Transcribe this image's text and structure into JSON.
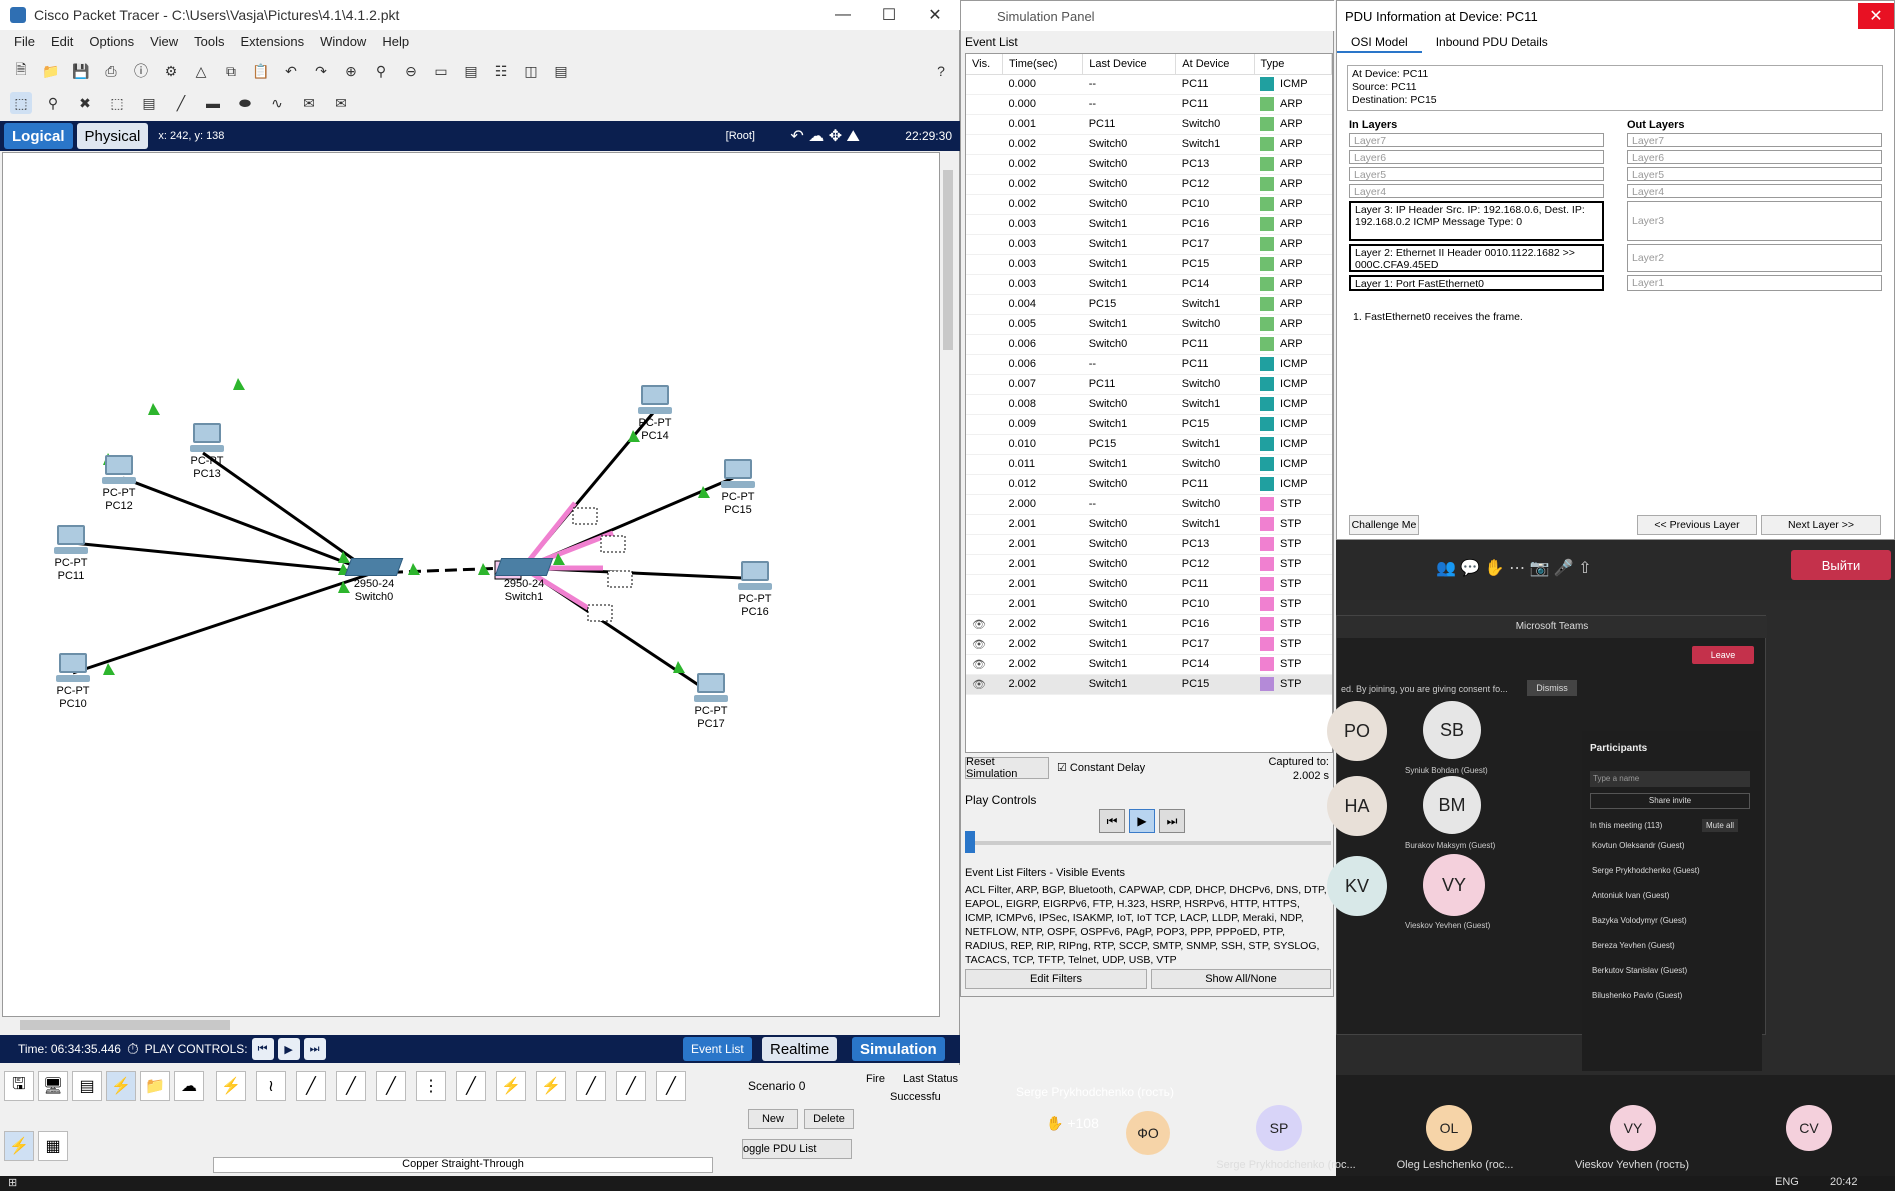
{
  "pt": {
    "title": "Cisco Packet Tracer - C:\\Users\\Vasja\\Pictures\\4.1\\4.1.2.pkt",
    "menu": [
      "File",
      "Edit",
      "Options",
      "View",
      "Tools",
      "Extensions",
      "Window",
      "Help"
    ],
    "tab_logical": "Logical",
    "tab_physical": "Physical",
    "coords": "x: 242, y: 138",
    "root": "[Root]",
    "clock": "22:29:30",
    "devices": {
      "pc10": {
        "model": "PC-PT",
        "name": "PC10"
      },
      "pc11": {
        "model": "PC-PT",
        "name": "PC11"
      },
      "pc12": {
        "model": "PC-PT",
        "name": "PC12"
      },
      "pc13": {
        "model": "PC-PT",
        "name": "PC13"
      },
      "pc14": {
        "model": "PC-PT",
        "name": "PC14"
      },
      "pc15": {
        "model": "PC-PT",
        "name": "PC15"
      },
      "pc16": {
        "model": "PC-PT",
        "name": "PC16"
      },
      "pc17": {
        "model": "PC-PT",
        "name": "PC17"
      },
      "switch0": {
        "model": "2950-24",
        "name": "Switch0"
      },
      "switch1": {
        "model": "2950-24",
        "name": "Switch1"
      }
    },
    "sim_time": "Time: 06:34:35.446",
    "play_controls": "PLAY CONTROLS:",
    "mode_event_list": "Event List",
    "mode_realtime": "Realtime",
    "mode_simulation": "Simulation",
    "cable_label": "Copper Straight-Through",
    "scenario": "Scenario 0",
    "new_btn": "New",
    "delete_btn": "Delete",
    "toggle_pdu": "oggle PDU List Window",
    "fire_col": "Fire",
    "last_status_col": "Last Status",
    "last_status_val": "Successfu"
  },
  "sim": {
    "title": "Simulation Panel",
    "event_list": "Event List",
    "columns": [
      "Vis.",
      "Time(sec)",
      "Last Device",
      "At Device",
      "Type"
    ],
    "events": [
      [
        "",
        "0.000",
        "--",
        "PC11",
        "ICMP"
      ],
      [
        "",
        "0.000",
        "--",
        "PC11",
        "ARP"
      ],
      [
        "",
        "0.001",
        "PC11",
        "Switch0",
        "ARP"
      ],
      [
        "",
        "0.002",
        "Switch0",
        "Switch1",
        "ARP"
      ],
      [
        "",
        "0.002",
        "Switch0",
        "PC13",
        "ARP"
      ],
      [
        "",
        "0.002",
        "Switch0",
        "PC12",
        "ARP"
      ],
      [
        "",
        "0.002",
        "Switch0",
        "PC10",
        "ARP"
      ],
      [
        "",
        "0.003",
        "Switch1",
        "PC16",
        "ARP"
      ],
      [
        "",
        "0.003",
        "Switch1",
        "PC17",
        "ARP"
      ],
      [
        "",
        "0.003",
        "Switch1",
        "PC15",
        "ARP"
      ],
      [
        "",
        "0.003",
        "Switch1",
        "PC14",
        "ARP"
      ],
      [
        "",
        "0.004",
        "PC15",
        "Switch1",
        "ARP"
      ],
      [
        "",
        "0.005",
        "Switch1",
        "Switch0",
        "ARP"
      ],
      [
        "",
        "0.006",
        "Switch0",
        "PC11",
        "ARP"
      ],
      [
        "",
        "0.006",
        "--",
        "PC11",
        "ICMP"
      ],
      [
        "",
        "0.007",
        "PC11",
        "Switch0",
        "ICMP"
      ],
      [
        "",
        "0.008",
        "Switch0",
        "Switch1",
        "ICMP"
      ],
      [
        "",
        "0.009",
        "Switch1",
        "PC15",
        "ICMP"
      ],
      [
        "",
        "0.010",
        "PC15",
        "Switch1",
        "ICMP"
      ],
      [
        "",
        "0.011",
        "Switch1",
        "Switch0",
        "ICMP"
      ],
      [
        "",
        "0.012",
        "Switch0",
        "PC11",
        "ICMP"
      ],
      [
        "",
        "2.000",
        "--",
        "Switch0",
        "STP"
      ],
      [
        "",
        "2.001",
        "Switch0",
        "Switch1",
        "STP"
      ],
      [
        "",
        "2.001",
        "Switch0",
        "PC13",
        "STP"
      ],
      [
        "",
        "2.001",
        "Switch0",
        "PC12",
        "STP"
      ],
      [
        "",
        "2.001",
        "Switch0",
        "PC11",
        "STP"
      ],
      [
        "",
        "2.001",
        "Switch0",
        "PC10",
        "STP"
      ],
      [
        "eye",
        "2.002",
        "Switch1",
        "PC16",
        "STP"
      ],
      [
        "eye",
        "2.002",
        "Switch1",
        "PC17",
        "STP"
      ],
      [
        "eye",
        "2.002",
        "Switch1",
        "PC14",
        "STP"
      ],
      [
        "eye",
        "2.002",
        "Switch1",
        "PC15",
        "STP"
      ]
    ],
    "type_colors": {
      "ICMP": "#20a0a0",
      "ARP": "#6fbf6f",
      "STP": "#f080d0"
    },
    "reset": "Reset Simulation",
    "constant_delay": "Constant Delay",
    "captured_to": "Captured to:",
    "captured_val": "2.002 s",
    "play_controls": "Play Controls",
    "filters_label": "Event List Filters - Visible Events",
    "filters": "ACL Filter, ARP, BGP, Bluetooth, CAPWAP, CDP, DHCP, DHCPv6, DNS, DTP, EAPOL, EIGRP, EIGRPv6, FTP, H.323, HSRP, HSRPv6, HTTP, HTTPS, ICMP, ICMPv6, IPSec, ISAKMP, IoT, IoT TCP, LACP, LLDP, Meraki, NDP, NETFLOW, NTP, OSPF, OSPFv6, PAgP, POP3, PPP, PPPoED, PTP, RADIUS, REP, RIP, RIPng, RTP, SCCP, SMTP, SNMP, SSH, STP, SYSLOG, TACACS, TCP, TFTP, Telnet, UDP, USB, VTP",
    "edit_filters": "Edit Filters",
    "show_all": "Show All/None"
  },
  "pdu": {
    "title": "PDU Information at Device: PC11",
    "tab_osi": "OSI Model",
    "tab_inbound": "Inbound PDU Details",
    "info_at": "At Device: PC11",
    "info_src": "Source: PC11",
    "info_dst": "Destination: PC15",
    "in_layers": "In Layers",
    "out_layers": "Out Layers",
    "in7": "Layer7",
    "in6": "Layer6",
    "in5": "Layer5",
    "in4": "Layer4",
    "in3": "Layer 3: IP Header Src. IP: 192.168.0.6, Dest. IP: 192.168.0.2 ICMP Message Type: 0",
    "in2": "Layer 2: Ethernet II Header 0010.1122.1682 >> 000C.CFA9.45ED",
    "in1": "Layer 1: Port FastEthernet0",
    "out7": "Layer7",
    "out6": "Layer6",
    "out5": "Layer5",
    "out4": "Layer4",
    "out3": "Layer3",
    "out2": "Layer2",
    "out1": "Layer1",
    "note": "1. FastEthernet0 receives the frame.",
    "challenge": "Challenge Me",
    "prev": "<< Previous Layer",
    "next": "Next Layer >>"
  },
  "teams": {
    "leave": "Leave",
    "inner_title": "Microsoft Teams",
    "dismiss": "Dismiss",
    "consent": "ed. By joining, you are giving consent fo...",
    "participants": "Participants",
    "type_name": "Type a name",
    "share_invite": "Share invite",
    "in_meeting": "In this meeting (113)",
    "mute_all": "Mute all",
    "people": [
      "Kovtun Oleksandr (Guest)",
      "Serge Prykhodchenko (Guest)",
      "Antoniuk Ivan (Guest)",
      "Bazyka Volodymyr (Guest)",
      "Bereza Yevhen (Guest)",
      "Berkutov Stanislav (Guest)",
      "Bilushenko Pavlo (Guest)"
    ],
    "tile_sb": "SB",
    "tile_sb_name": "Syniuk Bohdan (Guest)",
    "tile_bm": "BM",
    "tile_bm_name": "Burakov Maksym (Guest)",
    "tile_vy": "VY",
    "tile_vy_name": "Vieskov Yevhen (Guest)",
    "tile_po": "PO",
    "tile_ha": "HA",
    "tile_kv": "KV",
    "speaker": "Serge Prykhodchenko (гость)",
    "hands": "+108",
    "bottom": [
      {
        "init": "ФО",
        "name": ""
      },
      {
        "init": "SP",
        "name": "Serge Prykhodchenko (roc..."
      },
      {
        "init": "OL",
        "name": "Oleg Leshchenko (roc..."
      },
      {
        "init": "VY",
        "name": "Vieskov Yevhen (гость)"
      },
      {
        "init": "CV",
        "name": ""
      }
    ],
    "leave_ru": "Выйти",
    "taskbar_time": "20:42",
    "taskbar_lang": "ENG"
  }
}
